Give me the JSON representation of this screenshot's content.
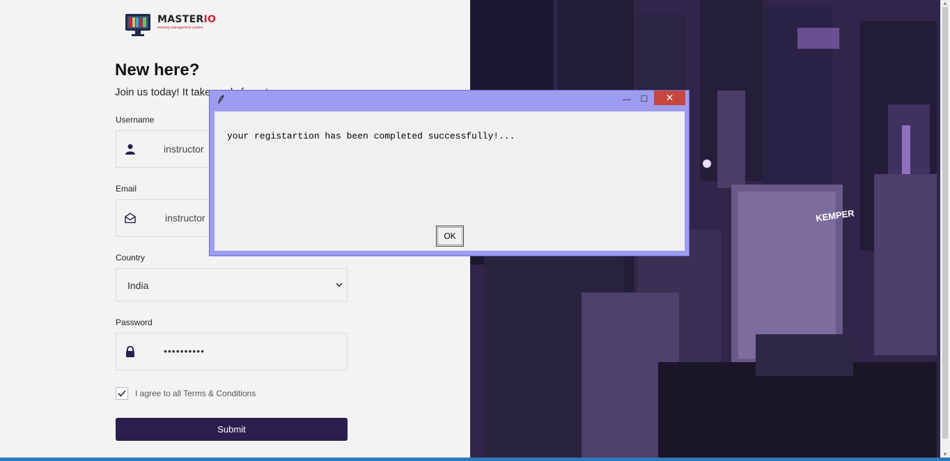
{
  "logo": {
    "name": "MASTER",
    "name_accent": "IO",
    "tagline": "learning management system"
  },
  "form": {
    "heading": "New here?",
    "subheading": "Join us today! It takes only few steps",
    "username": {
      "label": "Username",
      "value": "instructor"
    },
    "email": {
      "label": "Email",
      "value": "instructor"
    },
    "country": {
      "label": "Country",
      "value": "India"
    },
    "password": {
      "label": "Password",
      "value": "••••••••••"
    },
    "terms_label": "I agree to all Terms & Conditions",
    "submit_label": "Submit"
  },
  "dialog": {
    "message": "your registartion has been completed successfully!...",
    "ok_label": "OK",
    "close_glyph": "✕",
    "max_glyph": "☐",
    "min_glyph": "—"
  },
  "city_sign": "KEMPER",
  "colors": {
    "accent": "#2b1f4d",
    "dialog_frame": "#9e9cf0",
    "close_red": "#c7463f"
  }
}
